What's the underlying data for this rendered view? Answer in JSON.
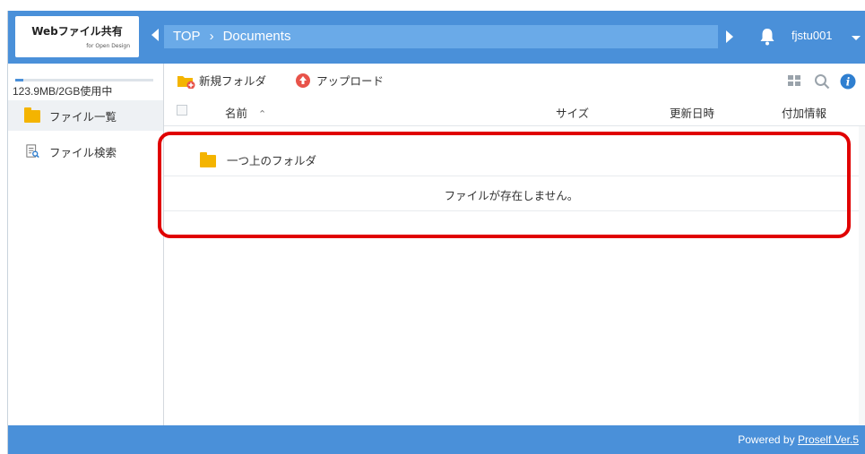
{
  "logo": {
    "title": "Webファイル共有",
    "subtitle": "for Open Design"
  },
  "breadcrumb": {
    "root": "TOP",
    "separator": "›",
    "current": "Documents"
  },
  "user": {
    "name": "fjstu001"
  },
  "sidebar": {
    "quota_text": "123.9MB/2GB使用中",
    "quota_fraction": 0.06,
    "items": [
      {
        "label": "ファイル一覧",
        "icon": "folder-icon",
        "active": true
      },
      {
        "label": "ファイル検索",
        "icon": "file-search-icon",
        "active": false
      }
    ]
  },
  "toolbar": {
    "new_folder_label": "新規フォルダ",
    "upload_label": "アップロード",
    "icons": [
      "grid-view-icon",
      "search-icon",
      "info-icon"
    ]
  },
  "table": {
    "columns": {
      "name": "名前",
      "size": "サイズ",
      "modified": "更新日時",
      "info": "付加情報"
    },
    "sort_indicator": "^",
    "parent_folder_label": "一つ上のフォルダ",
    "empty_message": "ファイルが存在しません。"
  },
  "footer": {
    "powered_prefix": "Powered by",
    "powered_link": "Proself Ver.5"
  },
  "colors": {
    "header": "#4a90d9",
    "breadcrumb": "#6aaae8",
    "folder": "#f4b400",
    "highlight": "#e00000",
    "upload": "#e8534a",
    "info": "#2f7fd0"
  }
}
